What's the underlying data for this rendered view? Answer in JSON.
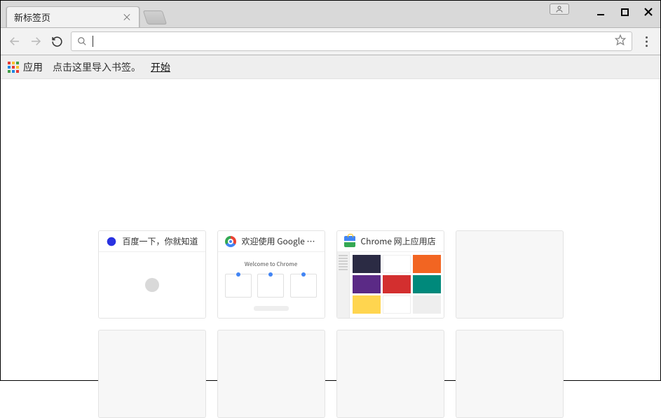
{
  "window": {
    "profile_tooltip": "用户",
    "minimize": "最小化",
    "maximize": "最大化",
    "close": "关闭"
  },
  "tab": {
    "title": "新标签页",
    "close_tooltip": "关闭标签页"
  },
  "toolbar": {
    "back_tooltip": "返回",
    "forward_tooltip": "前进",
    "reload_tooltip": "重新加载",
    "omnibox_value": "",
    "omnibox_placeholder": "",
    "star_tooltip": "为此页添加书签",
    "menu_tooltip": "自定义及控制 Google Chrome"
  },
  "bookmarks_bar": {
    "apps_label": "应用",
    "import_hint": "点击这里导入书签。",
    "begin_link": "开始"
  },
  "ntp_tiles": [
    {
      "favicon": "baidu",
      "title": "百度一下，你就知道",
      "thumb": "baidu"
    },
    {
      "favicon": "chrome",
      "title": "欢迎使用 Google C...",
      "thumb": "welcome"
    },
    {
      "favicon": "webstore",
      "title": "Chrome 网上应用店",
      "thumb": "webstore"
    },
    {
      "favicon": "",
      "title": "",
      "thumb": ""
    },
    {
      "favicon": "",
      "title": "",
      "thumb": ""
    },
    {
      "favicon": "",
      "title": "",
      "thumb": ""
    },
    {
      "favicon": "",
      "title": "",
      "thumb": ""
    },
    {
      "favicon": "",
      "title": "",
      "thumb": ""
    }
  ]
}
